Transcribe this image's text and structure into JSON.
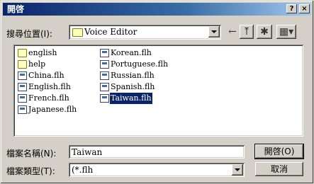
{
  "window": {
    "title": "開啓",
    "help_button": "?",
    "close_button": "×"
  },
  "lookin": {
    "label": "搜尋位置(I):",
    "value": "Voice Editor"
  },
  "files": {
    "col1": [
      {
        "name": "english",
        "kind": "folder"
      },
      {
        "name": "help",
        "kind": "folder"
      },
      {
        "name": "China.flh",
        "kind": "file"
      },
      {
        "name": "English.flh",
        "kind": "file"
      },
      {
        "name": "French.flh",
        "kind": "file"
      },
      {
        "name": "Japanese.flh",
        "kind": "file"
      }
    ],
    "col2": [
      {
        "name": "Korean.flh",
        "kind": "file"
      },
      {
        "name": "Portuguese.flh",
        "kind": "file"
      },
      {
        "name": "Russian.flh",
        "kind": "file"
      },
      {
        "name": "Spanish.flh",
        "kind": "file"
      },
      {
        "name": "Taiwan.flh",
        "kind": "file",
        "selected": true
      }
    ]
  },
  "filename": {
    "label": "檔案名稱(N):",
    "value": "Taiwan"
  },
  "filetype": {
    "label": "檔案類型(T):",
    "value": "(*.flh"
  },
  "buttons": {
    "open": "開啓(O)",
    "cancel": "取消"
  }
}
